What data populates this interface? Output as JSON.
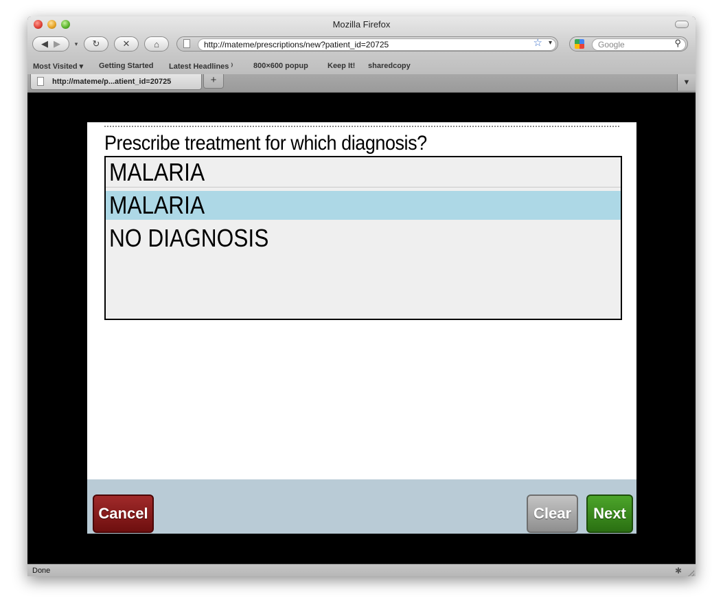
{
  "window": {
    "title": "Mozilla Firefox"
  },
  "toolbar": {
    "back_icon": "back-arrow-icon",
    "forward_icon": "forward-arrow-icon",
    "url": "http://mateme/prescriptions/new?patient_id=20725",
    "search_placeholder": "Google"
  },
  "bookmarks": [
    {
      "label": "Most Visited ▾"
    },
    {
      "label": "Getting Started"
    },
    {
      "label": "Latest Headlines ⁾"
    },
    {
      "label": "800×600 popup"
    },
    {
      "label": "Keep It!"
    },
    {
      "label": "sharedcopy"
    }
  ],
  "tabs": [
    {
      "label": "http://mateme/p...atient_id=20725"
    }
  ],
  "page": {
    "question": "Prescribe treatment for which diagnosis?",
    "input_value": "MALARIA",
    "options": [
      {
        "label": "MALARIA",
        "selected": true
      },
      {
        "label": "NO DIAGNOSIS",
        "selected": false
      }
    ],
    "selected_color": "#add8e6",
    "buttons": {
      "cancel": "Cancel",
      "clear": "Clear",
      "next": "Next"
    }
  },
  "status": {
    "text": "Done"
  }
}
